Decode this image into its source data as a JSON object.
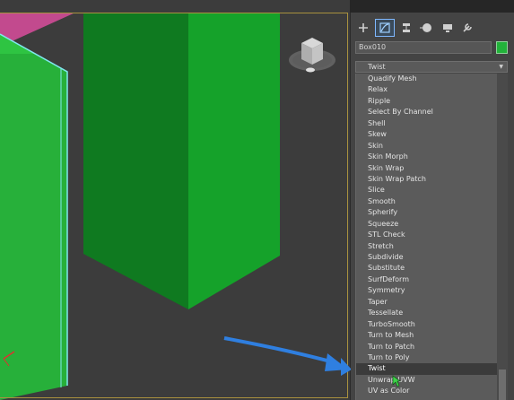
{
  "viewport": {
    "label": "Perspective viewport"
  },
  "command_panel": {
    "tabs": [
      {
        "icon": "plus-icon"
      },
      {
        "icon": "modify-icon",
        "active": true
      },
      {
        "icon": "hierarchy-icon"
      },
      {
        "icon": "motion-icon"
      },
      {
        "icon": "display-icon"
      },
      {
        "icon": "utilities-wrench-icon"
      }
    ],
    "object_name": "Box010",
    "object_color": "#22b33a",
    "modifier_dropdown_value": "Twist",
    "modifiers": [
      "Quadify Mesh",
      "Relax",
      "Ripple",
      "Select By Channel",
      "Shell",
      "Skew",
      "Skin",
      "Skin Morph",
      "Skin Wrap",
      "Skin Wrap Patch",
      "Slice",
      "Smooth",
      "Spherify",
      "Squeeze",
      "STL Check",
      "Stretch",
      "Subdivide",
      "Substitute",
      "SurfDeform",
      "Symmetry",
      "Taper",
      "Tessellate",
      "TurboSmooth",
      "Turn to Mesh",
      "Turn to Patch",
      "Turn to Poly",
      "Twist",
      "Unwrap UVW",
      "UV as Color"
    ],
    "selected_modifier": "Twist"
  },
  "colors": {
    "viewport_bg": "#3c3c3c",
    "box_green": "#22b33a",
    "accent_blue": "#2f7fe0"
  }
}
